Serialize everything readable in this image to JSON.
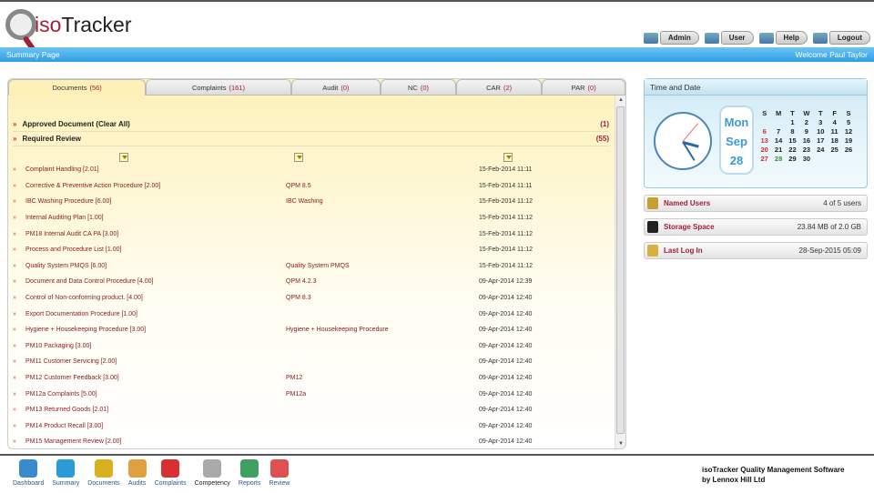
{
  "app": {
    "logo_iso": "iso",
    "logo_tracker": "Tracker",
    "page_title": "Summary Page",
    "welcome": "Welcome Paul Taylor"
  },
  "top_buttons": [
    {
      "label": "Admin",
      "icon": "admin-icon"
    },
    {
      "label": "User",
      "icon": "users-icon"
    },
    {
      "label": "Help",
      "icon": "help-icon"
    },
    {
      "label": "Logout",
      "icon": "logout-icon"
    }
  ],
  "tabs": [
    {
      "label": "Documents",
      "count": "(56)"
    },
    {
      "label": "Complaints",
      "count": "(161)"
    },
    {
      "label": "Audit",
      "count": "(0)"
    },
    {
      "label": "NC",
      "count": "(0)"
    },
    {
      "label": "CAR",
      "count": "(2)"
    },
    {
      "label": "PAR",
      "count": "(0)"
    }
  ],
  "sections": [
    {
      "label": "Approved Document  (Clear All)",
      "count": "(1)"
    },
    {
      "label": "Required Review",
      "count": "(55)"
    }
  ],
  "rows": [
    {
      "name": "Complaint Handling [2.01]",
      "code": "",
      "date": "15-Feb-2014 11:11"
    },
    {
      "name": "Corrective & Preventive Action Procedure [2.00]",
      "code": "QPM 8.5",
      "date": "15-Feb-2014 11:11"
    },
    {
      "name": "IBC Washing Procedure [6.00]",
      "code": "IBC Washing",
      "date": "15-Feb-2014 11:12"
    },
    {
      "name": "Internal Auditing Plan [1.00]",
      "code": "",
      "date": "15-Feb-2014 11:12"
    },
    {
      "name": "PM18 Internal Audit CA PA [3.00]",
      "code": "",
      "date": "15-Feb-2014 11:12"
    },
    {
      "name": "Process and Procedure List [1.00]",
      "code": "",
      "date": "15-Feb-2014 11:12"
    },
    {
      "name": "Quality System PMQS [6.00]",
      "code": "Quality System PMQS",
      "date": "15-Feb-2014 11:12"
    },
    {
      "name": "Document and Data Control Procedure [4.00]",
      "code": "QPM 4.2.3",
      "date": "09-Apr-2014 12:39"
    },
    {
      "name": "Control of Non-conforming product. [4.00]",
      "code": "QPM 8.3",
      "date": "09-Apr-2014 12:40"
    },
    {
      "name": "Export Documentation Procedure [1.00]",
      "code": "",
      "date": "09-Apr-2014 12:40"
    },
    {
      "name": "Hygiene + Housekeeping Procedure [3.00]",
      "code": "Hygiene + Housekeeping Procedure",
      "date": "09-Apr-2014 12:40"
    },
    {
      "name": "PM10 Packaging [3.00]",
      "code": "",
      "date": "09-Apr-2014 12:40"
    },
    {
      "name": "PM11 Customer Servicing [2.00]",
      "code": "",
      "date": "09-Apr-2014 12:40"
    },
    {
      "name": "PM12 Customer Feedback [3.00]",
      "code": "PM12",
      "date": "09-Apr-2014 12:40"
    },
    {
      "name": "PM12a Complaints [5.00]",
      "code": "PM12a",
      "date": "09-Apr-2014 12:40"
    },
    {
      "name": "PM13 Returned Goods [2.01]",
      "code": "",
      "date": "09-Apr-2014 12:40"
    },
    {
      "name": "PM14 Product Recall [3.00]",
      "code": "",
      "date": "09-Apr-2014 12:40"
    },
    {
      "name": "PM15 Management Review [2.00]",
      "code": "",
      "date": "09-Apr-2014 12:40"
    }
  ],
  "time_date": {
    "title": "Time and Date",
    "day": "Mon",
    "month": "Sep",
    "date": "28",
    "weekdays": [
      "S",
      "M",
      "T",
      "W",
      "T",
      "F",
      "S"
    ],
    "days": [
      "",
      "",
      "1",
      "2",
      "3",
      "4",
      "5",
      "6",
      "7",
      "8",
      "9",
      "10",
      "11",
      "12",
      "13",
      "14",
      "15",
      "16",
      "17",
      "18",
      "19",
      "20",
      "21",
      "22",
      "23",
      "24",
      "25",
      "26",
      "27",
      "28",
      "29",
      "30"
    ]
  },
  "info": [
    {
      "label": "Named Users",
      "value": "4 of 5 users",
      "icon": "named-users-icon"
    },
    {
      "label": "Storage Space",
      "value": "23.84 MB of 2.0 GB",
      "icon": "storage-icon"
    },
    {
      "label": "Last Log In",
      "value": "28-Sep-2015 05:09",
      "icon": "key-icon"
    }
  ],
  "nav": [
    {
      "label": "Dashboard",
      "color": "#3a8ad0"
    },
    {
      "label": "Summary",
      "color": "#2a9ad8"
    },
    {
      "label": "Documents",
      "color": "#d8b020"
    },
    {
      "label": "Audits",
      "color": "#e0a040"
    },
    {
      "label": "Complaints",
      "color": "#d83030"
    },
    {
      "label": "Competency",
      "color": "#aaaaaa"
    },
    {
      "label": "Reports",
      "color": "#40a060"
    },
    {
      "label": "Review",
      "color": "#e05050"
    }
  ],
  "footer": {
    "line1": "isoTracker Quality Management Software",
    "line2": "by Lennox Hill Ltd"
  }
}
